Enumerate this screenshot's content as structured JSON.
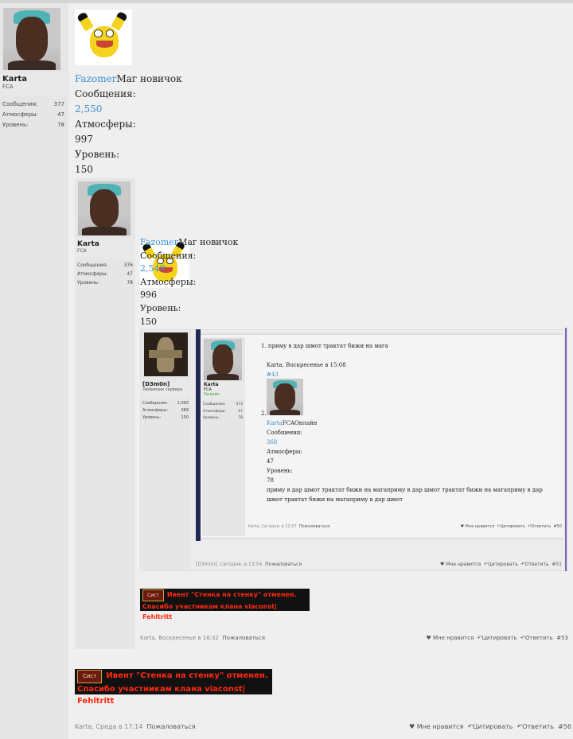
{
  "post1": {
    "user": {
      "name": "Karta",
      "title": "FCA",
      "stats": [
        {
          "label": "Сообщения:",
          "value": "377"
        },
        {
          "label": "Атмосферы:",
          "value": "47"
        },
        {
          "label": "Уровень:",
          "value": "78"
        }
      ]
    },
    "sig": {
      "name": "Fazomer",
      "rank": "Маг новичок",
      "messages_label": "Сообщения:",
      "messages": "2,550",
      "atm_label": "Атмосферы:",
      "atm": "997",
      "level_label": "Уровень:",
      "level": "150"
    }
  },
  "post2": {
    "user": {
      "name": "Karta",
      "title": "FCA",
      "stats": [
        {
          "label": "Сообщения:",
          "value": "376"
        },
        {
          "label": "Атмосферы:",
          "value": "47"
        },
        {
          "label": "Уровень:",
          "value": "78"
        }
      ]
    },
    "sig": {
      "name": "Fazomer",
      "rank": "Маг новичок",
      "messages_label": "Сообщения:",
      "messages": "2,549",
      "atm_label": "Атмосферы:",
      "atm": "996",
      "level_label": "Уровень:",
      "level": "150"
    },
    "footer": {
      "meta": "Karta, Воскресенье в 16:32",
      "report": "Пожаловаться",
      "like": "Мне нравится",
      "quote": "Цитировать",
      "reply": "Ответить",
      "num": "#53"
    }
  },
  "nested": {
    "user": {
      "name": "[D3m0n]",
      "title": "Любимчик сервера",
      "stats": [
        {
          "label": "Сообщения:",
          "value": "1,093"
        },
        {
          "label": "Атмосферы:",
          "value": "389"
        },
        {
          "label": "Уровень:",
          "value": "150"
        }
      ]
    },
    "footer": {
      "meta": "[D3m0n], Сегодня, в 13:54",
      "report": "Пожаловаться",
      "like": "Мне нравится",
      "quote": "Цитировать",
      "reply": "Ответить",
      "num": "#51"
    },
    "inner_user": {
      "name": "Karta",
      "title": "FCA",
      "status": "Онлайн",
      "stats": [
        {
          "label": "Сообщения:",
          "value": "373"
        },
        {
          "label": "Атмосферы:",
          "value": "47"
        },
        {
          "label": "Уровень:",
          "value": "78"
        }
      ]
    },
    "inner": {
      "item1": "1. приму в дар шмот трактат бижи на мага",
      "cite": "Karta, Воскресенье в 15:08",
      "anchor": "#43",
      "num2": "2.",
      "name": "Karta",
      "rank": "FCAОнлайн",
      "messages_label": "Сообщения:",
      "messages": "368",
      "atm_label": "Атмосферы:",
      "atm": "47",
      "level_label": "Уровень:",
      "level": "78",
      "text": "приму в дар шмот трактат бижи на магаприму в дар шмот трактат бижи на магаприму в дар шмот трактат бижи на магаприму в дар шмот"
    },
    "inner_footer": {
      "meta": "Karta, Сегодня, в 12:07",
      "report": "Пожаловаться",
      "like": "Мне нравится",
      "quote": "Цитировать",
      "reply": "Ответить",
      "num": "#50"
    }
  },
  "banner": {
    "tag": "Сист",
    "line1": "Ивент \"Стенка на стенку\" отменен.",
    "line2": "Спасибо участникам клана viaconst| Fehltritt"
  },
  "footer_main": {
    "meta": "Karta, Среда в 17:14",
    "report": "Пожаловаться",
    "like": "Мне нравится",
    "quote": "Цитировать",
    "reply": "Ответить",
    "num": "#56"
  }
}
